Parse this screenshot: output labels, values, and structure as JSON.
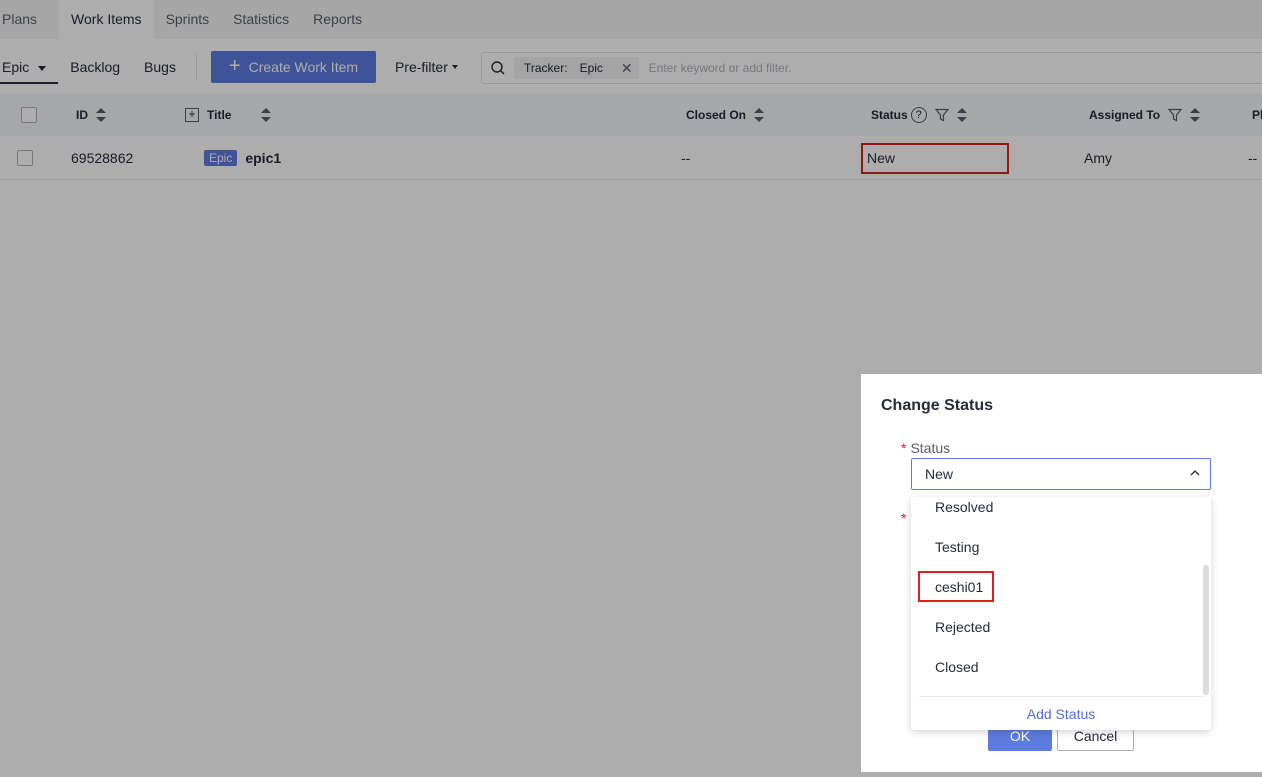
{
  "top_tabs": [
    "Plans",
    "Work Items",
    "Sprints",
    "Statistics",
    "Reports"
  ],
  "sub_tabs": {
    "epic": "Epic",
    "backlog": "Backlog",
    "bugs": "Bugs"
  },
  "toolbar": {
    "create_label": "Create Work Item",
    "prefilter_label": "Pre-filter"
  },
  "search": {
    "chip_key": "Tracker:",
    "chip_value": "Epic",
    "placeholder": "Enter keyword or add filter."
  },
  "table": {
    "headers": {
      "id": "ID",
      "title": "Title",
      "closed_on": "Closed On",
      "status": "Status",
      "assigned_to": "Assigned To",
      "partial": "Pl"
    },
    "row": {
      "id": "69528862",
      "type_tag": "Epic",
      "title": "epic1",
      "closed_on": "--",
      "status": "New",
      "assigned_to": "Amy",
      "partial": "--"
    }
  },
  "dialog": {
    "title": "Change Status",
    "status_label": "Status",
    "required_mark": "*",
    "selected_value": "New",
    "ok_label": "OK",
    "cancel_label": "Cancel"
  },
  "dropdown": {
    "options": [
      "Resolved",
      "Testing",
      "ceshi01",
      "Rejected",
      "Closed"
    ],
    "highlighted": "ceshi01",
    "add_label": "Add Status"
  },
  "colors": {
    "accent": "#5e7ce0",
    "highlight_border": "#e02020"
  }
}
